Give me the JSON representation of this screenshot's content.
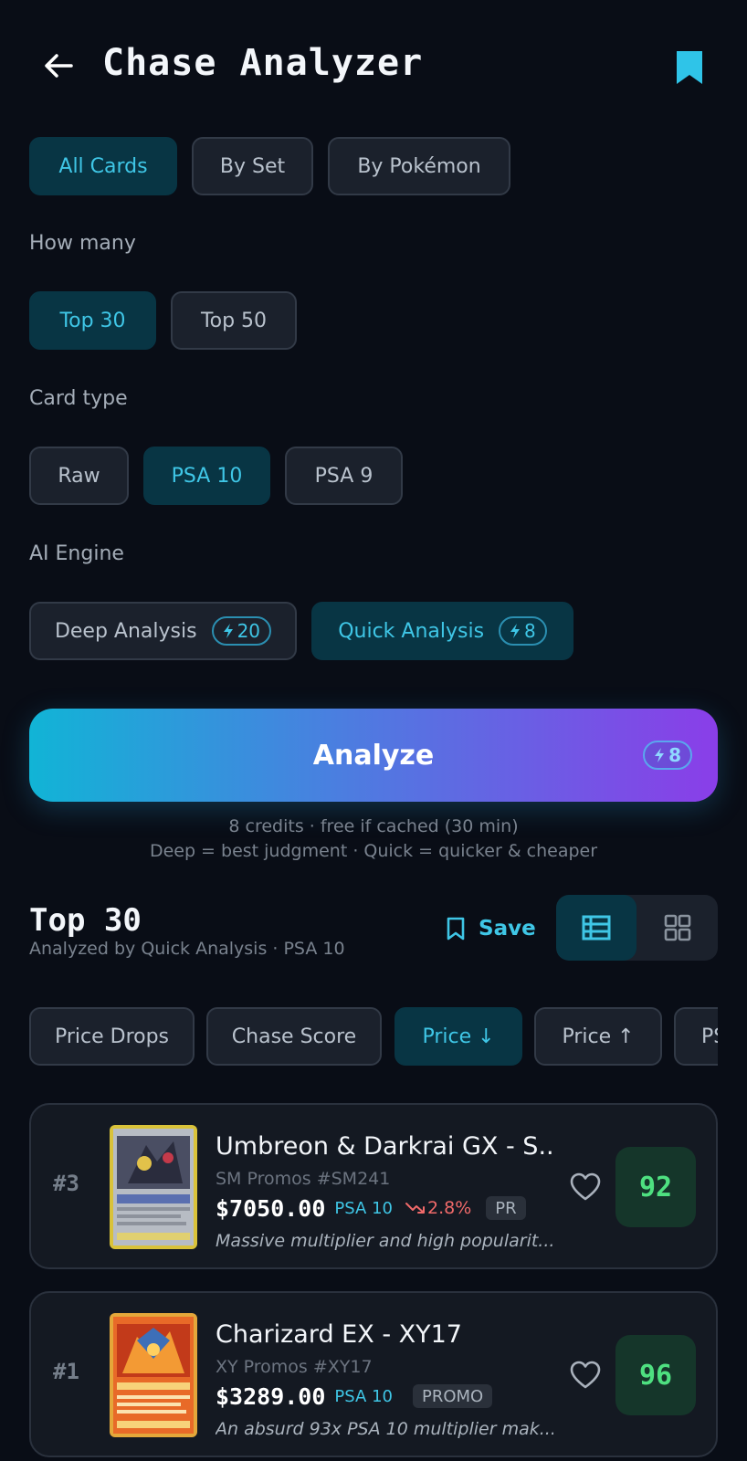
{
  "header": {
    "title": "Chase Analyzer"
  },
  "scope_tabs": [
    {
      "label": "All Cards",
      "active": true
    },
    {
      "label": "By Set",
      "active": false
    },
    {
      "label": "By Pokémon",
      "active": false
    }
  ],
  "how_many": {
    "label": "How many",
    "options": [
      {
        "label": "Top 30",
        "active": true
      },
      {
        "label": "Top 50",
        "active": false
      }
    ]
  },
  "card_type": {
    "label": "Card type",
    "options": [
      {
        "label": "Raw",
        "active": false
      },
      {
        "label": "PSA 10",
        "active": true
      },
      {
        "label": "PSA 9",
        "active": false
      }
    ]
  },
  "ai_engine": {
    "label": "AI Engine",
    "options": [
      {
        "label": "Deep Analysis",
        "credits": "20",
        "active": false
      },
      {
        "label": "Quick Analysis",
        "credits": "8",
        "active": true
      }
    ]
  },
  "analyze": {
    "label": "Analyze",
    "credits": "8",
    "note_line1": "8 credits · free if cached (30 min)",
    "note_line2": "Deep = best judgment · Quick = quicker & cheaper"
  },
  "results": {
    "title": "Top 30",
    "subtitle": "Analyzed by Quick Analysis · PSA 10",
    "save_label": "Save",
    "view": "list"
  },
  "sort_options": [
    {
      "label": "Price Drops",
      "active": false
    },
    {
      "label": "Chase Score",
      "active": false
    },
    {
      "label": "Price ↓",
      "active": true
    },
    {
      "label": "Price ↑",
      "active": false
    },
    {
      "label": "PS",
      "active": false
    }
  ],
  "cards": [
    {
      "rank": "#3",
      "name": "Umbreon & Darkrai GX - S...",
      "set": "SM Promos #SM241",
      "price": "$7050.00",
      "grade": "PSA 10",
      "change": "2.8%",
      "tag": "PR",
      "description": "Massive multiplier and high popularit...",
      "score": "92"
    },
    {
      "rank": "#1",
      "name": "Charizard EX - XY17",
      "set": "XY Promos #XY17",
      "price": "$3289.00",
      "grade": "PSA 10",
      "change": "",
      "tag": "PROMO",
      "description": "An absurd 93x PSA 10 multiplier mak...",
      "score": "96"
    }
  ],
  "colors": {
    "background": "#090d16",
    "accent": "#3fc6e6",
    "active_chip": "#083544",
    "score_green": "#4ee080",
    "drop_red": "#f06a6a",
    "gradient_start": "#11b4d6",
    "gradient_end": "#8a3ee8"
  }
}
